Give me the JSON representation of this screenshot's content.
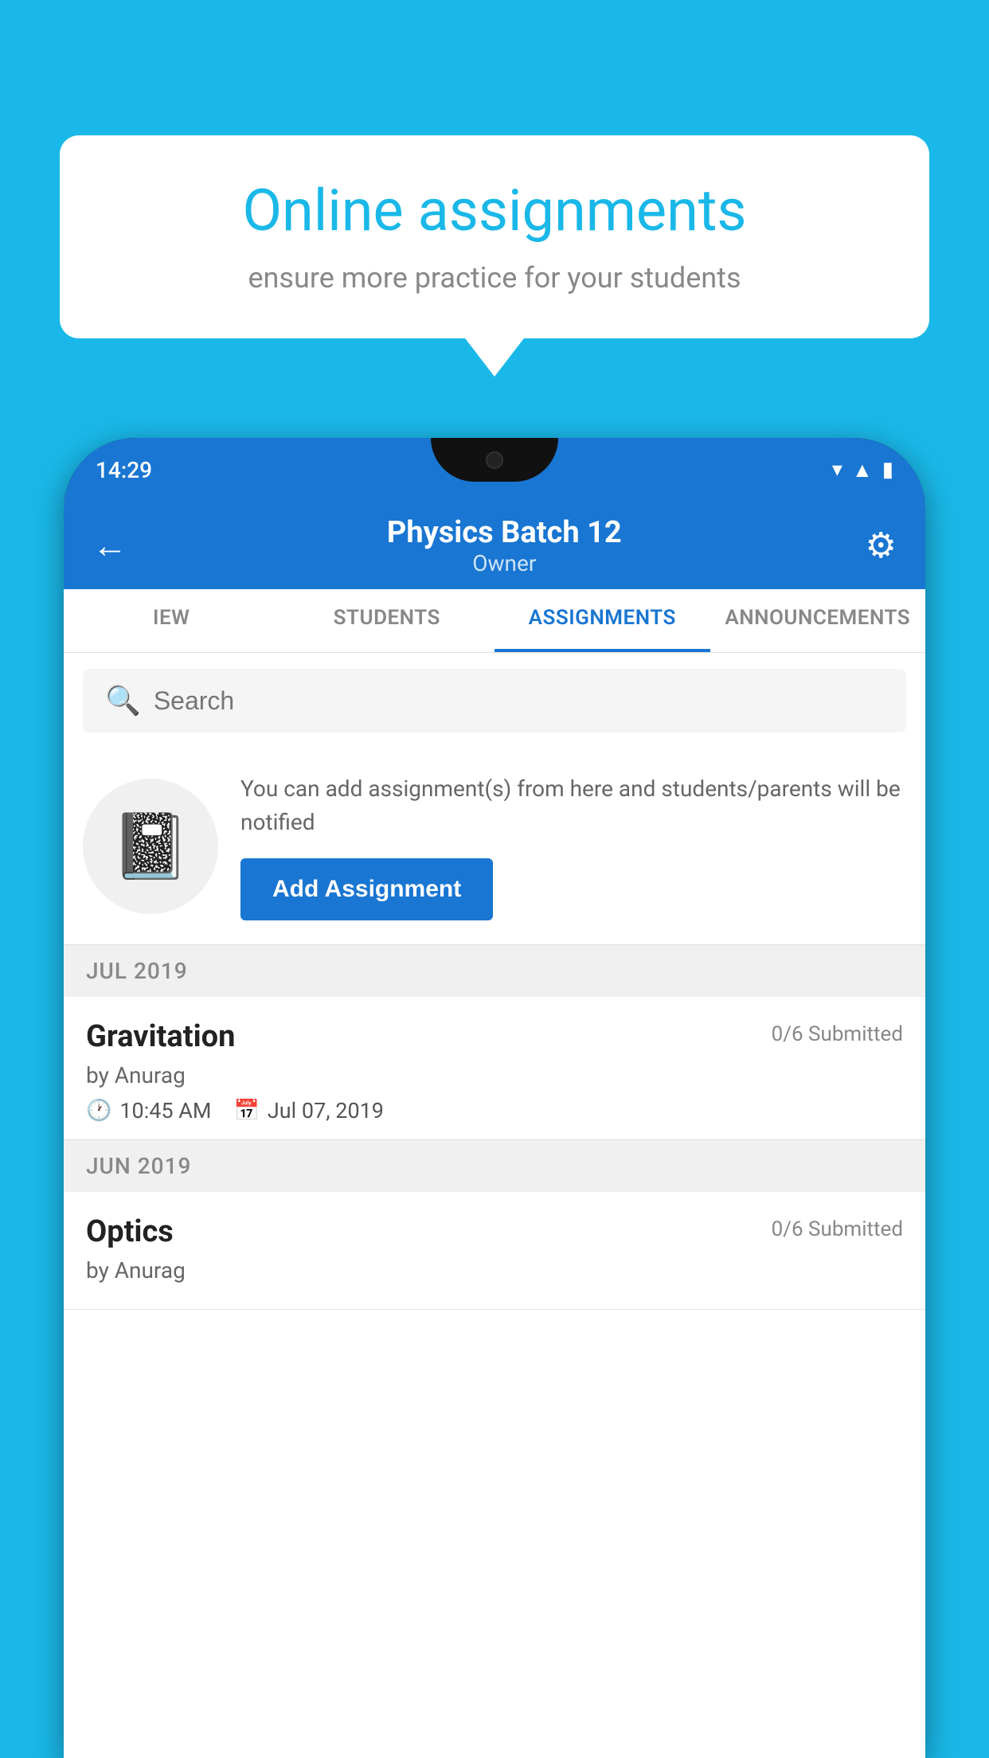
{
  "background_color": "#1ab8e8",
  "speech_bubble": {
    "title": "Online assignments",
    "subtitle": "ensure more practice for your students"
  },
  "phone": {
    "status_bar": {
      "time": "14:29",
      "icons": [
        "wifi",
        "signal",
        "battery"
      ]
    },
    "app_bar": {
      "back_label": "←",
      "title": "Physics Batch 12",
      "subtitle": "Owner",
      "gear_label": "⚙"
    },
    "tabs": [
      {
        "label": "IEW",
        "active": false
      },
      {
        "label": "STUDENTS",
        "active": false
      },
      {
        "label": "ASSIGNMENTS",
        "active": true
      },
      {
        "label": "ANNOUNCEMENTS",
        "active": false
      }
    ],
    "search": {
      "placeholder": "Search"
    },
    "promo": {
      "description": "You can add assignment(s) from here and students/parents will be notified",
      "button_label": "Add Assignment"
    },
    "assignments": [
      {
        "month": "JUL 2019",
        "items": [
          {
            "name": "Gravitation",
            "submitted": "0/6 Submitted",
            "by": "by Anurag",
            "time": "10:45 AM",
            "date": "Jul 07, 2019"
          }
        ]
      },
      {
        "month": "JUN 2019",
        "items": [
          {
            "name": "Optics",
            "submitted": "0/6 Submitted",
            "by": "by Anurag",
            "time": "",
            "date": ""
          }
        ]
      }
    ]
  }
}
